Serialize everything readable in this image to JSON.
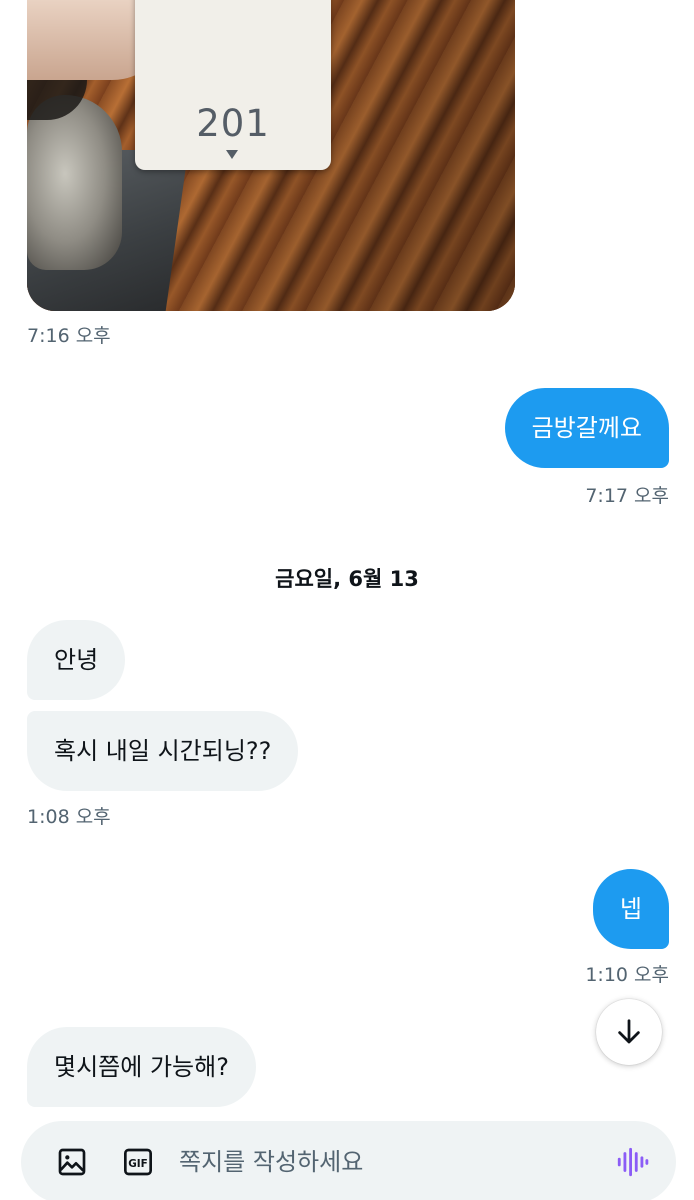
{
  "photo": {
    "card_number": "201",
    "timestamp": "7:16 오후"
  },
  "messages": [
    {
      "direction": "out",
      "text": "금방갈께요",
      "timestamp": "7:17 오후"
    }
  ],
  "date_divider": "금요일, 6월 13",
  "day_messages": [
    {
      "direction": "in",
      "text": "안녕"
    },
    {
      "direction": "in",
      "text": "혹시 내일 시간되닝??",
      "timestamp": "1:08 오후"
    },
    {
      "direction": "out",
      "text": "넵",
      "timestamp": "1:10 오후"
    },
    {
      "direction": "in",
      "text": "몇시쯤에 가능해?"
    }
  ],
  "composer": {
    "placeholder": "쪽지를 작성하세요",
    "gif_label": "GIF"
  },
  "colors": {
    "accent": "#1d9bf0",
    "bubble_in": "#eff3f4",
    "timestamp": "#536471",
    "voice_icon": "#8b5cf6"
  },
  "icons": {
    "composer_image": "image-icon",
    "composer_gif": "gif-icon",
    "composer_voice": "voice-icon",
    "scroll_down": "arrow-down-icon"
  }
}
